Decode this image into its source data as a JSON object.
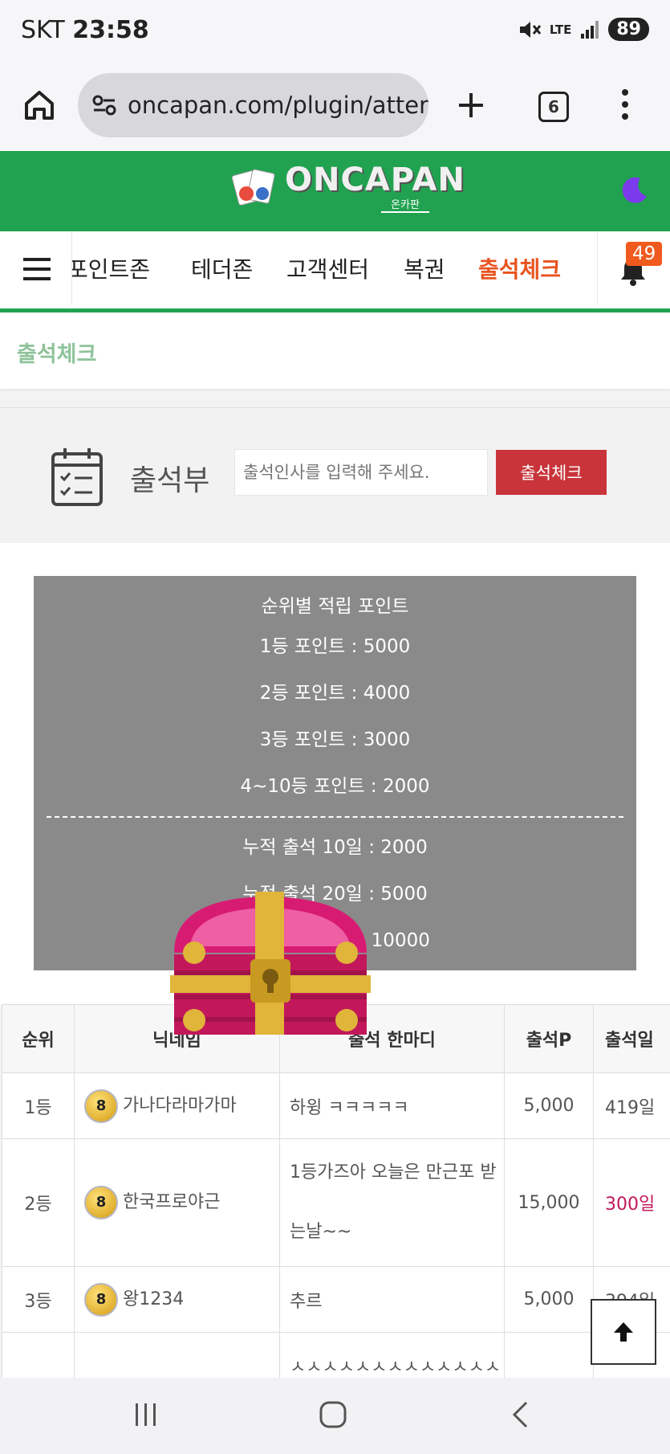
{
  "status_bar": {
    "carrier": "SKT",
    "time": "23:58",
    "network": "LTE",
    "battery": "89"
  },
  "browser": {
    "url": "oncapan.com/plugin/attenc",
    "tab_count": "6"
  },
  "site": {
    "logo_text": "ONCAPAN",
    "logo_sub": "온카판"
  },
  "nav": {
    "items": [
      "포인트존",
      "테더존",
      "고객센터",
      "복권",
      "출석체크"
    ],
    "active": "출석체크",
    "notification_count": "49"
  },
  "page_title": "출석체크",
  "attendance": {
    "label": "출석부",
    "input_placeholder": "출석인사를 입력해 주세요.",
    "button_label": "출석체크"
  },
  "points_panel": {
    "heading": "순위별 적립 포인트",
    "rank_points": [
      "1등 포인트 : 5000",
      "2등 포인트 : 4000",
      "3등 포인트 : 3000",
      "4~10등 포인트 : 2000"
    ],
    "cumulative": [
      "누적 출석 10일 : 2000",
      "누적 출석 20일 : 5000",
      "다 : 10000"
    ]
  },
  "table": {
    "headers": [
      "순위",
      "닉네임",
      "출석 한마디",
      "출석P",
      "출석일"
    ],
    "rows": [
      {
        "rank": "1등",
        "level": "8",
        "nickname": "가나다라마가마",
        "comment": "하윙 ㅋㅋㅋㅋㅋ",
        "points": "5,000",
        "days": "419일"
      },
      {
        "rank": "2등",
        "level": "8",
        "nickname": "한국프로야근",
        "comment": "1등가즈아 오늘은 만근포 받는날~~",
        "points": "15,000",
        "days": "300일"
      },
      {
        "rank": "3등",
        "level": "8",
        "nickname": "왕1234",
        "comment": "추르",
        "points": "5,000",
        "days": "394일"
      },
      {
        "rank": "",
        "level": "",
        "nickname": "",
        "comment": "ㅅㅅㅅㅅㅅㅅㅅㅅㅅㅅㅅㅅㅅ",
        "points": "",
        "days": ""
      }
    ]
  },
  "colors": {
    "header_green": "#21a250",
    "nav_active": "#e8541f",
    "button_red": "#c8343a",
    "panel_gray": "#8a8a8a",
    "highlight_days": "#c2185b"
  }
}
